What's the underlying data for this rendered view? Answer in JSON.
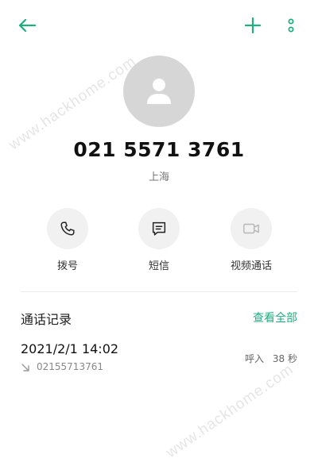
{
  "topbar": {
    "back_icon": "arrow-left-icon",
    "add_icon": "plus-icon",
    "more_icon": "more-vertical-icon",
    "accent_color": "#1fae7e"
  },
  "contact": {
    "avatar_icon": "person-icon",
    "phone_number": "021 5571 3761",
    "location": "上海"
  },
  "actions": [
    {
      "label": "拨号",
      "icon": "phone-icon"
    },
    {
      "label": "短信",
      "icon": "message-icon"
    },
    {
      "label": "视频通话",
      "icon": "video-camera-icon"
    }
  ],
  "call_history": {
    "title": "通话记录",
    "view_all": "查看全部",
    "entries": [
      {
        "datetime": "2021/2/1 14:02",
        "number": "02155713761",
        "type": "呼入",
        "duration": "38 秒",
        "direction_icon": "incoming-arrow-icon"
      }
    ]
  },
  "watermark": "www.hackhome.com"
}
